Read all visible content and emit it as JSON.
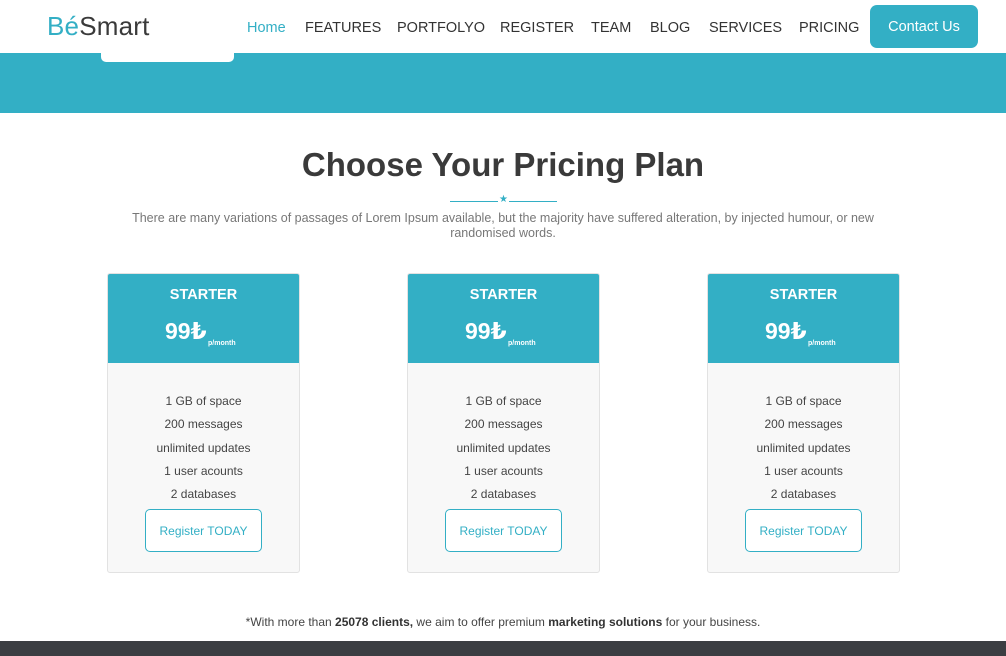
{
  "brand": {
    "part1": "Bé",
    "part2": "Smart"
  },
  "nav": {
    "items": [
      "Home",
      "FEATURES",
      "PORTFOLYO",
      "REGISTER",
      "TEAM",
      "BLOG",
      "SERVICES",
      "PRICING"
    ],
    "contact_label": "Contact Us"
  },
  "pricing": {
    "title": "Choose Your Pricing Plan",
    "divider_icon": "★",
    "subtitle": "There are many variations of passages of Lorem Ipsum available, but the majority have suffered alteration, by injected humour, or new randomised words.",
    "plans": [
      {
        "name": "STARTER",
        "price": "99₺",
        "period": "p/month",
        "features": [
          "1 GB of space",
          "200 messages",
          "unlimited updates",
          "1 user acounts",
          "2 databases"
        ],
        "button": "Register TODAY"
      },
      {
        "name": "STARTER",
        "price": "99₺",
        "period": "p/month",
        "features": [
          "1 GB of space",
          "200 messages",
          "unlimited updates",
          "1 user acounts",
          "2 databases"
        ],
        "button": "Register TODAY"
      },
      {
        "name": "STARTER",
        "price": "99₺",
        "period": "p/month",
        "features": [
          "1 GB of space",
          "200 messages",
          "unlimited updates",
          "1 user acounts",
          "2 databases"
        ],
        "button": "Register TODAY"
      }
    ],
    "footnote": {
      "t1": "*With more than ",
      "b1": "25078 clients,",
      "t2": " we aim to offer premium ",
      "b2": "marketing solutions",
      "t3": " for your business."
    }
  },
  "colors": {
    "accent": "#33afc5",
    "footer": "#3b3e42",
    "card_bg": "#f8f8f8"
  }
}
